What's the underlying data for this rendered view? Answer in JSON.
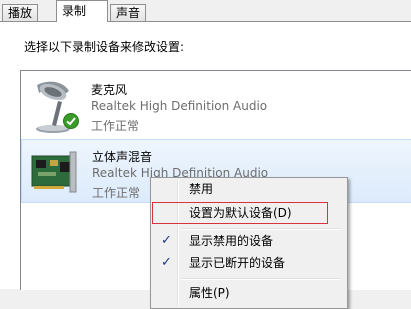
{
  "tabs": [
    {
      "label": "播放"
    },
    {
      "label": "录制"
    },
    {
      "label": "声音"
    }
  ],
  "instruction": "选择以下录制设备来修改设置:",
  "devices": [
    {
      "name": "麦克风",
      "driver": "Realtek High Definition Audio",
      "status": "工作正常",
      "icon": "microphone-icon",
      "default_badge": "check-badge-icon"
    },
    {
      "name": "立体声混音",
      "driver": "Realtek High Definition Audio",
      "status": "工作正常",
      "icon": "sound-card-icon"
    }
  ],
  "context_menu": {
    "items": [
      {
        "label": "禁用",
        "checked": false
      },
      {
        "label": "设置为默认设备(D)",
        "checked": false
      },
      {
        "label": "显示禁用的设备",
        "checked": true,
        "check": "✓"
      },
      {
        "label": "显示已断开的设备",
        "checked": true,
        "check": "✓"
      },
      {
        "label": "属性(P)",
        "checked": false
      }
    ]
  },
  "colors": {
    "selection_bg": "#dcebfc",
    "highlight_border": "#d8323c",
    "check_green": "#3a9b29"
  }
}
